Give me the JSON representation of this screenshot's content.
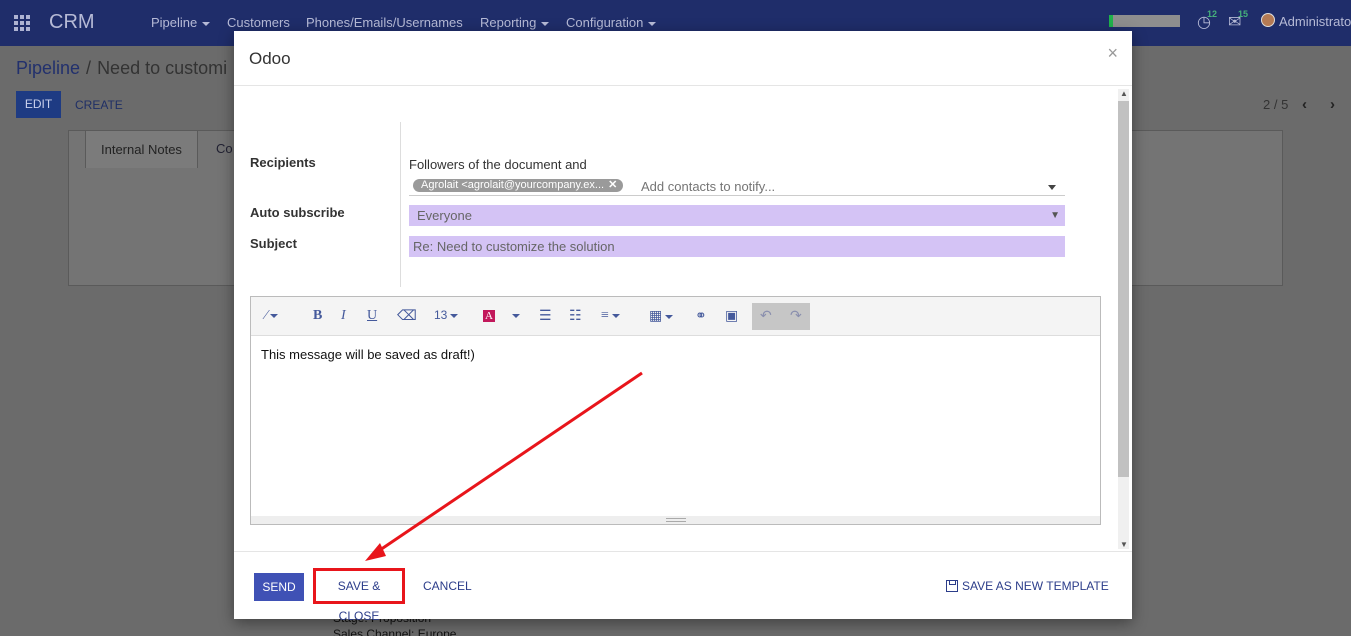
{
  "navbar": {
    "app_name": "CRM",
    "menu": [
      {
        "label": "Pipeline",
        "dropdown": true
      },
      {
        "label": "Customers",
        "dropdown": false
      },
      {
        "label": "Phones/Emails/Usernames",
        "dropdown": false
      },
      {
        "label": "Reporting",
        "dropdown": true
      },
      {
        "label": "Configuration",
        "dropdown": true
      }
    ],
    "activity_count": "12",
    "message_count": "15",
    "user": "Administrator"
  },
  "breadcrumb": {
    "root": "Pipeline",
    "current": "Need to customi"
  },
  "actions": {
    "edit": "EDIT",
    "create": "CREATE"
  },
  "pager": {
    "value": "2 / 5"
  },
  "tabs": {
    "internal_notes": "Internal Notes",
    "other": "Co"
  },
  "background_lines": [
    "Stage: Proposition",
    "Sales Channel: Europe"
  ],
  "modal": {
    "title": "Odoo",
    "close": "×",
    "recipients_label": "Recipients",
    "followers_text": "Followers of the document and",
    "recipient_tag": "Agrolait <agrolait@yourcompany.ex...",
    "contacts_placeholder": "Add contacts to notify...",
    "auto_subscribe_label": "Auto subscribe",
    "auto_subscribe_value": "Everyone",
    "subject_label": "Subject",
    "subject_value": "Re: Need to customize the solution",
    "font_size": "13",
    "body_text": "This message will be saved as draft!)",
    "footer": {
      "send": "SEND",
      "save_close": "SAVE & CLOSE",
      "cancel": "CANCEL",
      "save_template": "SAVE AS NEW TEMPLATE"
    }
  },
  "colors": {
    "navbar": "#1f2d6a",
    "primary": "#3f51b5",
    "required_field": "#d4c3f5",
    "annotation": "#e8151b"
  }
}
